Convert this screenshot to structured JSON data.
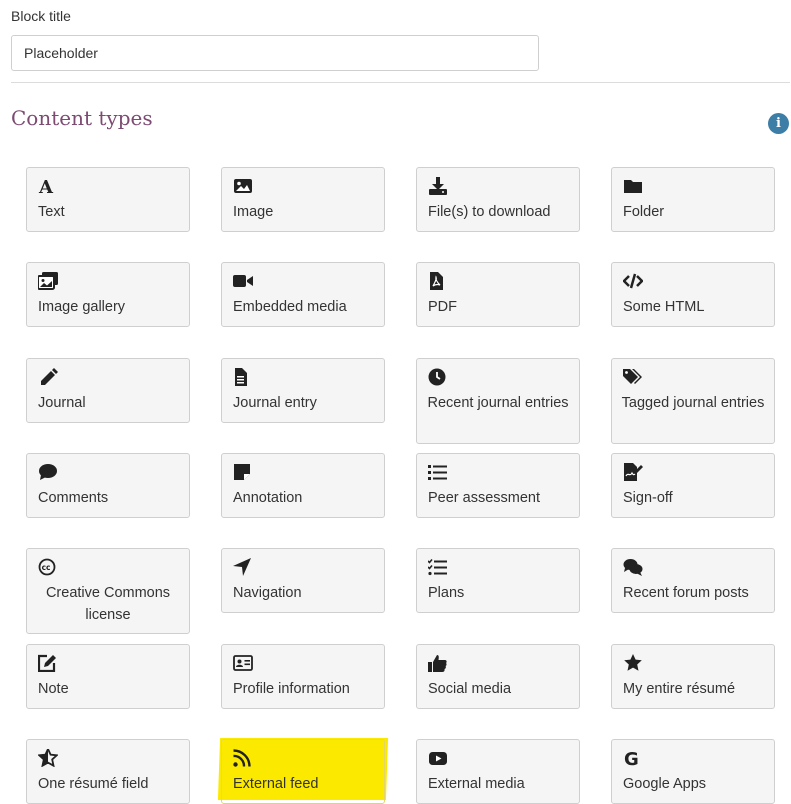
{
  "form": {
    "block_title_label": "Block title",
    "block_title_placeholder": "Placeholder"
  },
  "section": {
    "title": "Content types",
    "info_icon": "info-circle-icon"
  },
  "tiles": [
    {
      "label": "Text",
      "icon": "text-icon"
    },
    {
      "label": "Image",
      "icon": "image-icon"
    },
    {
      "label": "File(s) to download",
      "icon": "download-icon"
    },
    {
      "label": "Folder",
      "icon": "folder-icon"
    },
    {
      "label": "Image gallery",
      "icon": "image-gallery-icon"
    },
    {
      "label": "Embedded media",
      "icon": "video-camera-icon"
    },
    {
      "label": "PDF",
      "icon": "pdf-file-icon"
    },
    {
      "label": "Some HTML",
      "icon": "code-icon"
    },
    {
      "label": "Journal",
      "icon": "pencil-icon"
    },
    {
      "label": "Journal entry",
      "icon": "document-icon"
    },
    {
      "label": "Recent journal entries",
      "icon": "clock-icon"
    },
    {
      "label": "Tagged journal entries",
      "icon": "tags-icon"
    },
    {
      "label": "Comments",
      "icon": "comment-icon"
    },
    {
      "label": "Annotation",
      "icon": "sticky-note-icon"
    },
    {
      "label": "Peer assessment",
      "icon": "list-icon"
    },
    {
      "label": "Sign-off",
      "icon": "signature-icon"
    },
    {
      "label": "Creative Commons license",
      "icon": "creative-commons-icon"
    },
    {
      "label": "Navigation",
      "icon": "location-arrow-icon"
    },
    {
      "label": "Plans",
      "icon": "tasks-icon"
    },
    {
      "label": "Recent forum posts",
      "icon": "comments-icon"
    },
    {
      "label": "Note",
      "icon": "edit-icon"
    },
    {
      "label": "Profile information",
      "icon": "id-card-icon"
    },
    {
      "label": "Social media",
      "icon": "thumbs-up-icon"
    },
    {
      "label": "My entire résumé",
      "icon": "star-icon"
    },
    {
      "label": "One résumé field",
      "icon": "star-half-icon"
    },
    {
      "label": "External feed",
      "icon": "rss-icon"
    },
    {
      "label": "External media",
      "icon": "youtube-icon"
    },
    {
      "label": "Google Apps",
      "icon": "google-icon"
    }
  ],
  "colors": {
    "section_title": "#7d4a72",
    "info_icon": "#3d7ea6",
    "highlight": "#fbea00",
    "tile_background": "#f5f5f5",
    "tile_border": "#cfcfcf",
    "icon": "#222222"
  }
}
